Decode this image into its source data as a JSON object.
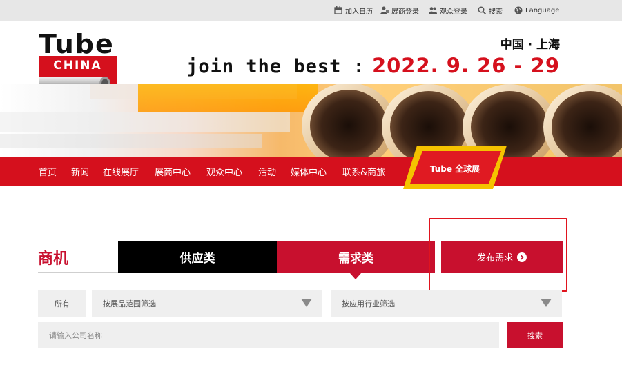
{
  "topbar": {
    "calendar_label": "加入日历",
    "exhibitor_login": "展商登录",
    "visitor_login": "观众登录",
    "search_label": "搜索",
    "language_label": "Language"
  },
  "header": {
    "logo_line1": "Tube",
    "logo_line2": "CHINA",
    "city": "中国 · 上海",
    "slogan": "join the best :",
    "dates": "2022. 9. 26 - 29"
  },
  "nav": {
    "items": [
      "首页",
      "新闻",
      "在线展厅",
      "展商中心",
      "观众中心",
      "活动",
      "媒体中心",
      "联系&商旅"
    ],
    "global_tab": "Tube 全球展"
  },
  "section": {
    "title": "商机",
    "tab_supply": "供应类",
    "tab_demand": "需求类",
    "publish_button": "发布需求"
  },
  "filters": {
    "all_label": "所有",
    "product_scope_placeholder": "按展品范围筛选",
    "industry_placeholder": "按应用行业筛选",
    "company_placeholder": "请输入公司名称",
    "search_button": "搜索"
  },
  "colors": {
    "brand_red": "#d5101d",
    "tab_black": "#000000",
    "accent_yellow": "#f5c200"
  }
}
